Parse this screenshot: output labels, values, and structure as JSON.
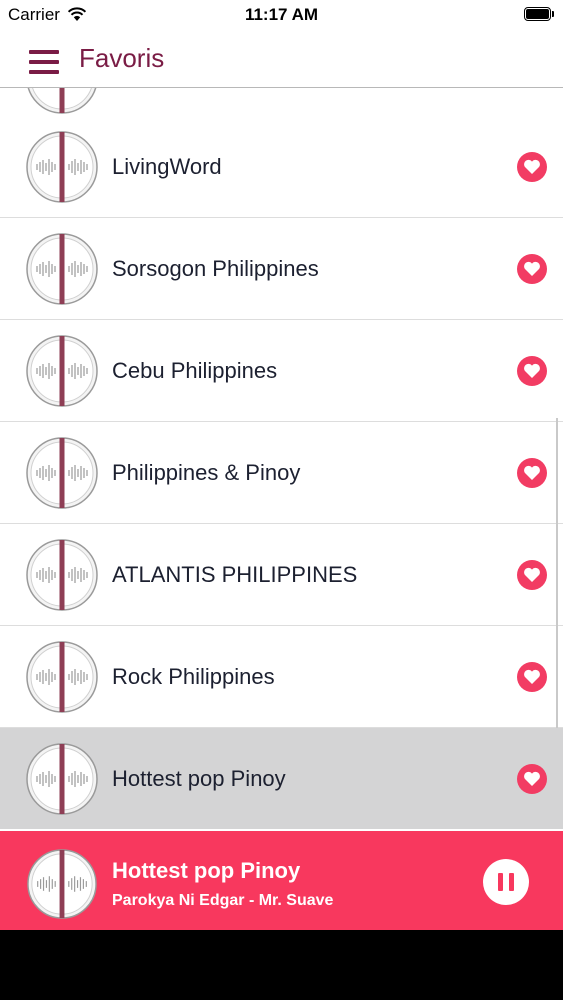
{
  "status_bar": {
    "carrier": "Carrier",
    "time": "11:17 AM"
  },
  "nav": {
    "title": "Favoris"
  },
  "stations": [
    {
      "name": "LivingWord"
    },
    {
      "name": "Sorsogon Philippines"
    },
    {
      "name": "Cebu Philippines"
    },
    {
      "name": "Philippines & Pinoy"
    },
    {
      "name": "ATLANTIS PHILIPPINES"
    },
    {
      "name": "Rock Philippines"
    },
    {
      "name": "Hottest pop Pinoy",
      "selected": true
    }
  ],
  "player": {
    "title": "Hottest pop Pinoy",
    "subtitle": "Parokya Ni Edgar - Mr. Suave",
    "state": "playing"
  },
  "colors": {
    "accent": "#f8385e",
    "heart": "#f23c63",
    "title": "#7a1c45",
    "selected_row": "#d4d4d5"
  },
  "icons": [
    "menu-icon",
    "radio-logo-icon",
    "heart-icon",
    "pause-icon",
    "wifi-icon",
    "battery-icon"
  ]
}
